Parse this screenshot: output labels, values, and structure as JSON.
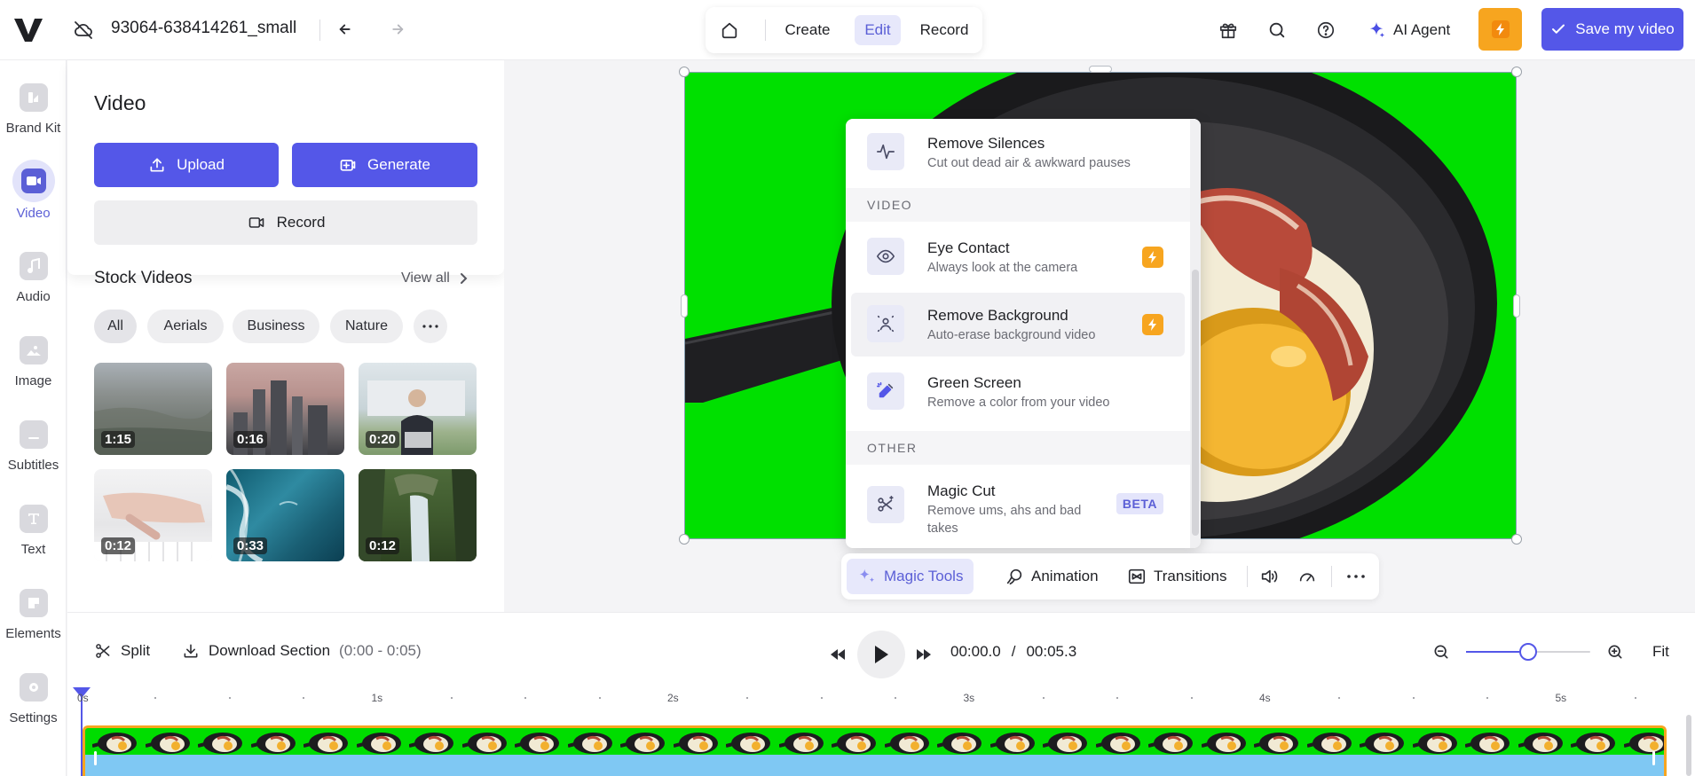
{
  "topbar": {
    "project_title": "93064-638414261_small",
    "modes": [
      "Create",
      "Edit",
      "Record"
    ],
    "active_mode": "Edit",
    "ai_agent_label": "AI Agent",
    "save_label": "Save my video"
  },
  "rail": {
    "items": [
      {
        "label": "Brand Kit",
        "icon": "brand-kit-icon"
      },
      {
        "label": "Video",
        "icon": "video-icon",
        "active": true
      },
      {
        "label": "Audio",
        "icon": "music-note-icon"
      },
      {
        "label": "Image",
        "icon": "image-icon"
      },
      {
        "label": "Subtitles",
        "icon": "subtitles-icon"
      },
      {
        "label": "Text",
        "icon": "text-icon"
      },
      {
        "label": "Elements",
        "icon": "elements-icon"
      },
      {
        "label": "Settings",
        "icon": "settings-icon"
      }
    ]
  },
  "panel": {
    "title": "Video",
    "upload_label": "Upload",
    "generate_label": "Generate",
    "record_label": "Record",
    "stock_title": "Stock Videos",
    "view_all": "View all",
    "chips": [
      "All",
      "Aerials",
      "Business",
      "Nature"
    ],
    "thumbnails": [
      {
        "duration": "1:15"
      },
      {
        "duration": "0:16"
      },
      {
        "duration": "0:20"
      },
      {
        "duration": "0:12"
      },
      {
        "duration": "0:33"
      },
      {
        "duration": "0:12"
      }
    ]
  },
  "magic_menu": {
    "items_top": [
      {
        "title": "Remove Silences",
        "subtitle": "Cut out dead air & awkward pauses"
      }
    ],
    "section_video": "VIDEO",
    "items_video": [
      {
        "title": "Eye Contact",
        "subtitle": "Always look at the camera",
        "badge": "pro"
      },
      {
        "title": "Remove Background",
        "subtitle": "Auto-erase background video",
        "badge": "pro"
      },
      {
        "title": "Green Screen",
        "subtitle": "Remove a color from your video"
      }
    ],
    "section_other": "OTHER",
    "items_other": [
      {
        "title": "Magic Cut",
        "subtitle": "Remove ums, ahs and bad takes",
        "badge": "BETA"
      }
    ]
  },
  "tools": {
    "magic_tools": "Magic Tools",
    "animation": "Animation",
    "transitions": "Transitions"
  },
  "timeline": {
    "split_label": "Split",
    "download_label": "Download Section",
    "download_range": "(0:00 - 0:05)",
    "current_time": "00:00.0",
    "separator": "/",
    "total_time": "00:05.3",
    "fit_label": "Fit",
    "zoom_level": 0.5,
    "ruler_labels": [
      "0s",
      "1s",
      "2s",
      "3s",
      "4s",
      "5s"
    ]
  },
  "colors": {
    "accent": "#5457e8",
    "pro": "#f7a51f",
    "green_screen": "#00e000",
    "track_border": "#f7a51f",
    "audio_track": "#7fc8f3"
  }
}
